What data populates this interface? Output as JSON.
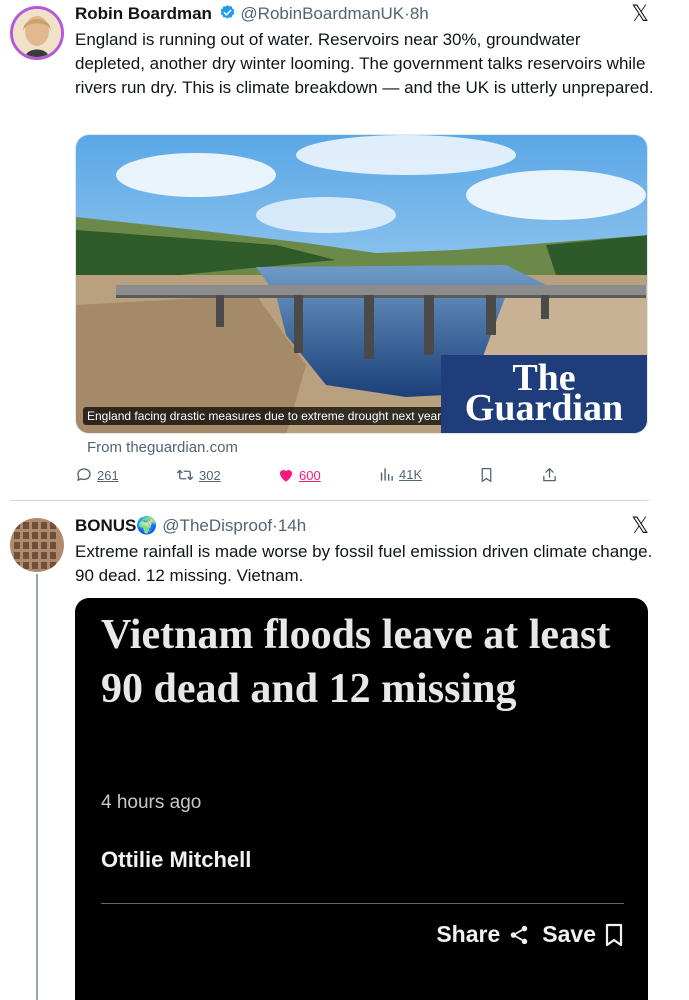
{
  "tweet1": {
    "display_name": "Robin Boardman",
    "handle": "@RobinBoardmanUK",
    "time": "8h",
    "text": "England is running out of water. Reservoirs near 30%, groundwater depleted, another dry winter looming. The government talks reservoirs while rivers run dry. This is climate breakdown — and the UK is utterly unprepared.",
    "card": {
      "caption": "England facing drastic measures due to extreme drought next year",
      "logo_line1": "The",
      "logo_line2": "Guardian",
      "source": "From theguardian.com"
    },
    "actions": {
      "replies": "261",
      "reposts": "302",
      "likes": "600",
      "views": "41K"
    }
  },
  "tweet2": {
    "display_name": "BONUS🌍",
    "handle": "@TheDisproof",
    "time": "14h",
    "text": "Extreme rainfall is made worse by fossil fuel emission driven climate change. 90 dead. 12 missing. Vietnam.",
    "news_card": {
      "headline": "Vietnam floods leave at least 90 dead and 12 missing",
      "time": "4 hours ago",
      "author": "Ottilie Mitchell",
      "share_label": "Share",
      "save_label": "Save"
    }
  },
  "colors": {
    "like_pink": "#f91880",
    "verified_blue": "#1d9bf0",
    "guardian_blue": "#1f3d7a",
    "avatar_ring": "#b45ad6"
  },
  "icons": [
    "verified-icon",
    "x-logo-icon",
    "reply-icon",
    "repost-icon",
    "heart-icon",
    "views-icon",
    "bookmark-icon",
    "share-icon",
    "share-nodes-icon",
    "save-bookmark-icon"
  ]
}
